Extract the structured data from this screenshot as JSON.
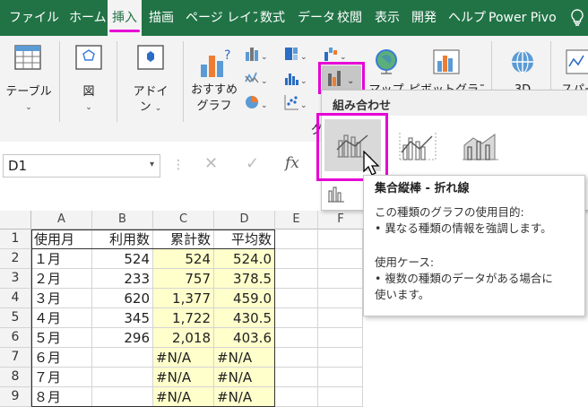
{
  "tabs": [
    {
      "label": "ファイル"
    },
    {
      "label": "ホーム"
    },
    {
      "label": "挿入",
      "active": true
    },
    {
      "label": "描画"
    },
    {
      "label": "ページ レイアウ"
    },
    {
      "label": "数式"
    },
    {
      "label": "データ"
    },
    {
      "label": "校閲"
    },
    {
      "label": "表示"
    },
    {
      "label": "開発"
    },
    {
      "label": "ヘルプ"
    },
    {
      "label": "Power Pivo"
    }
  ],
  "ribbon": {
    "table_label": "テーブル",
    "figure_label": "図",
    "addin_label_1": "アドイ",
    "addin_label_2": "ン",
    "rec_chart_1": "おすすめ",
    "rec_chart_2": "グラフ",
    "map_label": "マップ",
    "pivot_label": "ピボットグラフ",
    "threed_label": "3D",
    "sparkline_label": "スパー",
    "chev": "⌄",
    "group_partial": "グ"
  },
  "formula_bar": {
    "name_box": "D1",
    "cancel": "✕",
    "enter": "✓",
    "fx": "fx",
    "dots": "⋮"
  },
  "combo_panel": {
    "header": "組み合わせ"
  },
  "tooltip": {
    "title": "集合縦棒 - 折れ線",
    "purpose_heading": "この種類のグラフの使用目的:",
    "purpose_item": "• 異なる種類の情報を強調します。",
    "case_heading": "使用ケース:",
    "case_item_1": "• 複数の種類のデータがある場合に",
    "case_item_2": "使います。"
  },
  "sheet": {
    "columns": [
      "A",
      "B",
      "C",
      "D",
      "E",
      "F"
    ],
    "rows": [
      {
        "n": "1",
        "a": "使用月",
        "b": "利用数",
        "c": "累計数",
        "d": "平均数"
      },
      {
        "n": "2",
        "a": "１月",
        "b": "524",
        "c": "524",
        "d": "524.0"
      },
      {
        "n": "3",
        "a": "２月",
        "b": "233",
        "c": "757",
        "d": "378.5"
      },
      {
        "n": "4",
        "a": "３月",
        "b": "620",
        "c": "1,377",
        "d": "459.0"
      },
      {
        "n": "5",
        "a": "４月",
        "b": "345",
        "c": "1,722",
        "d": "430.5"
      },
      {
        "n": "6",
        "a": "５月",
        "b": "296",
        "c": "2,018",
        "d": "403.6"
      },
      {
        "n": "7",
        "a": "６月",
        "b": "",
        "c": "#N/A",
        "d": "#N/A"
      },
      {
        "n": "8",
        "a": "７月",
        "b": "",
        "c": "#N/A",
        "d": "#N/A"
      },
      {
        "n": "9",
        "a": "８月",
        "b": "",
        "c": "#N/A",
        "d": "#N/A"
      }
    ]
  },
  "colors": {
    "excel_green": "#217346",
    "highlight": "#e600d6",
    "cell_yellow": "#ffffcc"
  }
}
